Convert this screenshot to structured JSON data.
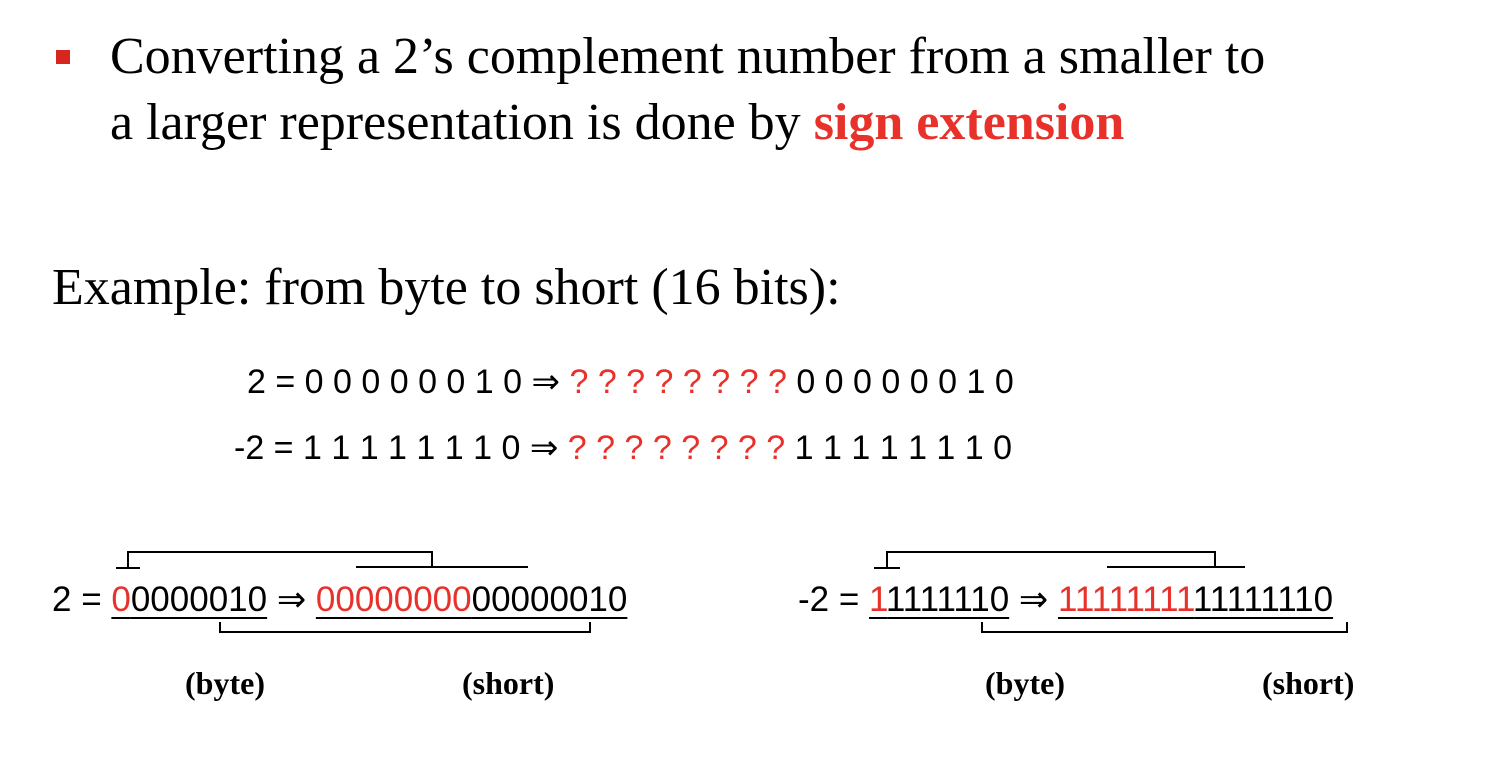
{
  "bullet": {
    "text_before": "Converting a 2’s complement number from a smaller to",
    "text_line2": "a larger representation is done by ",
    "emphasis": "sign extension"
  },
  "example_heading": "Example: from byte to short (16 bits):",
  "equations": [
    {
      "lhs": "2 = 0 0 0 0 0 0 1 0",
      "arrow": "⇒",
      "unknown": "? ? ? ? ? ? ? ?",
      "rhs": "0 0 0 0 0 0 1 0"
    },
    {
      "lhs": "-2 = 1 1 1 1 1 1 1 0",
      "arrow": "⇒",
      "unknown": "? ? ? ? ? ? ? ?",
      "rhs": "1 1 1 1 1 1 1 0"
    }
  ],
  "extension_left": {
    "prefix": "2 = ",
    "sign_bit": "0",
    "byte_rest": "0000010",
    "arrow": "⇒",
    "extended": "00000000",
    "short_low": "00000010",
    "byte_caption": "(byte)",
    "short_caption": "(short)"
  },
  "extension_right": {
    "prefix": "-2 = ",
    "sign_bit": "1",
    "byte_rest": "1111110",
    "arrow": "⇒",
    "extended": "11111111",
    "short_low": "11111110",
    "byte_caption": "(byte)",
    "short_caption": "(short)"
  },
  "colors": {
    "accent": "#e8312a",
    "bullet": "#d7261e"
  }
}
